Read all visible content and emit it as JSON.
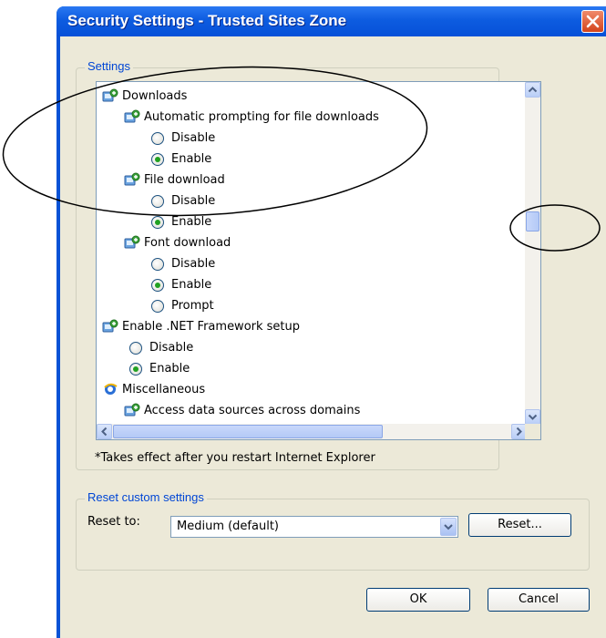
{
  "window": {
    "title": "Security Settings - Trusted Sites Zone"
  },
  "settings": {
    "legend": "Settings",
    "tree": [
      {
        "type": "category",
        "icon": "settings-icon",
        "label": "Downloads"
      },
      {
        "type": "setting",
        "icon": "settings-icon",
        "label": "Automatic prompting for file downloads"
      },
      {
        "type": "radio",
        "label": "Disable",
        "checked": false
      },
      {
        "type": "radio",
        "label": "Enable",
        "checked": true
      },
      {
        "type": "setting",
        "icon": "settings-icon",
        "label": "File download"
      },
      {
        "type": "radio",
        "label": "Disable",
        "checked": false
      },
      {
        "type": "radio",
        "label": "Enable",
        "checked": true
      },
      {
        "type": "setting",
        "icon": "settings-icon",
        "label": "Font download"
      },
      {
        "type": "radio",
        "label": "Disable",
        "checked": false
      },
      {
        "type": "radio",
        "label": "Enable",
        "checked": true
      },
      {
        "type": "radio",
        "label": "Prompt",
        "checked": false
      },
      {
        "type": "category",
        "icon": "settings-icon",
        "label": "Enable .NET Framework setup"
      },
      {
        "type": "radio",
        "label": "Disable",
        "checked": false
      },
      {
        "type": "radio",
        "label": "Enable",
        "checked": true
      },
      {
        "type": "category",
        "icon": "ie-icon",
        "label": "Miscellaneous"
      },
      {
        "type": "setting",
        "icon": "settings-icon",
        "label": "Access data sources across domains"
      }
    ],
    "note": "*Takes effect after you restart Internet Explorer"
  },
  "reset": {
    "legend": "Reset custom settings",
    "reset_to_label": "Reset to:",
    "selected_level": "Medium (default)",
    "reset_button": "Reset..."
  },
  "buttons": {
    "ok": "OK",
    "cancel": "Cancel"
  },
  "colors": {
    "titlebar": "#0a53d6",
    "dialog_bg": "#ece9d8",
    "group_label": "#0046d5",
    "radio_dot": "#21a121"
  }
}
